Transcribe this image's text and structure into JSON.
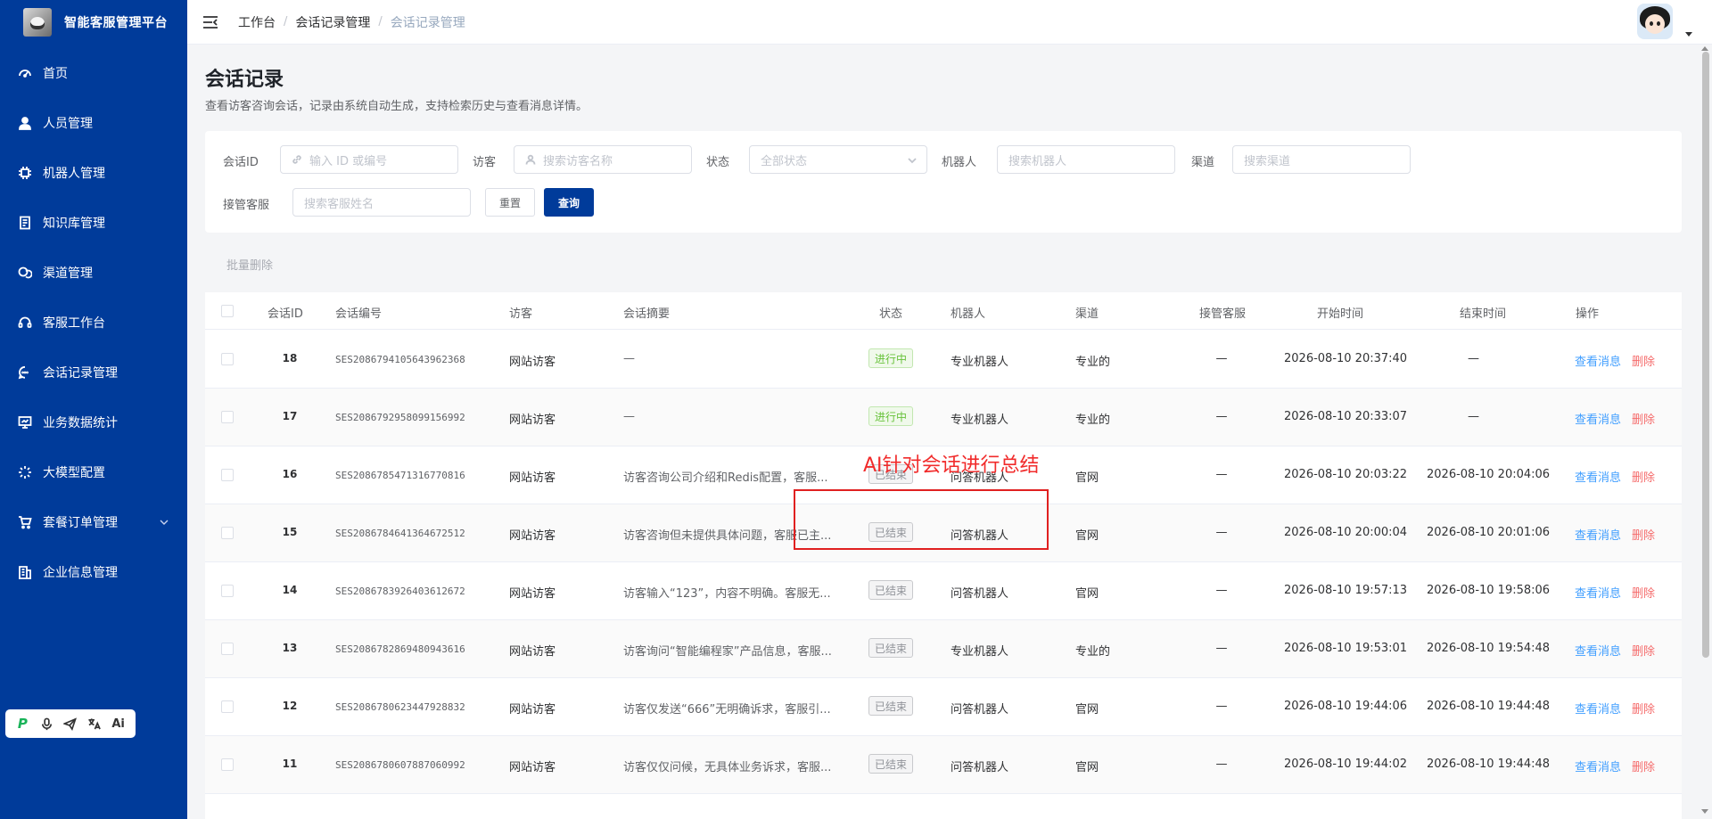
{
  "sidebar": {
    "title": "智能客服管理平台",
    "items": [
      {
        "label": "首页",
        "icon": "dashboard-icon"
      },
      {
        "label": "人员管理",
        "icon": "user-icon"
      },
      {
        "label": "机器人管理",
        "icon": "chip-icon"
      },
      {
        "label": "知识库管理",
        "icon": "book-icon"
      },
      {
        "label": "渠道管理",
        "icon": "link-icon"
      },
      {
        "label": "客服工作台",
        "icon": "headset-icon"
      },
      {
        "label": "会话记录管理",
        "icon": "chat-icon"
      },
      {
        "label": "业务数据统计",
        "icon": "monitor-icon"
      },
      {
        "label": "大模型配置",
        "icon": "sparkle-icon"
      },
      {
        "label": "套餐订单管理",
        "icon": "cart-icon",
        "has_children": true
      },
      {
        "label": "企业信息管理",
        "icon": "building-icon"
      }
    ]
  },
  "header": {
    "breadcrumb": [
      "工作台",
      "会话记录管理",
      "会话记录管理"
    ]
  },
  "page": {
    "title": "会话记录",
    "subtitle": "查看访客咨询会话，记录由系统自动生成，支持检索历史与查看消息详情。"
  },
  "filters": {
    "session_id_label": "会话ID",
    "session_id_placeholder": "输入 ID 或编号",
    "visitor_label": "访客",
    "visitor_placeholder": "搜索访客名称",
    "status_label": "状态",
    "status_value": "全部状态",
    "robot_label": "机器人",
    "robot_placeholder": "搜索机器人",
    "channel_label": "渠道",
    "channel_placeholder": "搜索渠道",
    "agent_label": "接管客服",
    "agent_placeholder": "搜索客服姓名",
    "reset_label": "重置",
    "query_label": "查询"
  },
  "batch_delete_label": "批量删除",
  "table": {
    "headers": {
      "id": "会话ID",
      "no": "会话编号",
      "visitor": "访客",
      "summary": "会话摘要",
      "status": "状态",
      "robot": "机器人",
      "channel": "渠道",
      "agent": "接管客服",
      "start": "开始时间",
      "end": "结束时间",
      "ops": "操作"
    },
    "view_label": "查看消息",
    "delete_label": "删除",
    "rows": [
      {
        "id": "18",
        "no": "SES2086794105643962368",
        "visitor": "网站访客",
        "summary": "—",
        "status": "进行中",
        "status_type": "run",
        "robot": "专业机器人",
        "channel": "专业的",
        "agent": "—",
        "start": "2026-08-10 20:37:40",
        "end": "—"
      },
      {
        "id": "17",
        "no": "SES2086792958099156992",
        "visitor": "网站访客",
        "summary": "—",
        "status": "进行中",
        "status_type": "run",
        "robot": "专业机器人",
        "channel": "专业的",
        "agent": "—",
        "start": "2026-08-10 20:33:07",
        "end": "—"
      },
      {
        "id": "16",
        "no": "SES2086785471316770816",
        "visitor": "网站访客",
        "summary": "访客咨询公司介绍和Redis配置，客服...",
        "status": "已结束",
        "status_type": "end",
        "robot": "问答机器人",
        "channel": "官网",
        "agent": "—",
        "start": "2026-08-10 20:03:22",
        "end": "2026-08-10 20:04:06"
      },
      {
        "id": "15",
        "no": "SES2086784641364672512",
        "visitor": "网站访客",
        "summary": "访客咨询但未提供具体问题，客服已主...",
        "status": "已结束",
        "status_type": "end",
        "robot": "问答机器人",
        "channel": "官网",
        "agent": "—",
        "start": "2026-08-10 20:00:04",
        "end": "2026-08-10 20:01:06"
      },
      {
        "id": "14",
        "no": "SES2086783926403612672",
        "visitor": "网站访客",
        "summary": "访客输入“123”，内容不明确。客服无...",
        "status": "已结束",
        "status_type": "end",
        "robot": "问答机器人",
        "channel": "官网",
        "agent": "—",
        "start": "2026-08-10 19:57:13",
        "end": "2026-08-10 19:58:06"
      },
      {
        "id": "13",
        "no": "SES2086782869480943616",
        "visitor": "网站访客",
        "summary": "访客询问“智能编程家”产品信息，客服...",
        "status": "已结束",
        "status_type": "end",
        "robot": "专业机器人",
        "channel": "专业的",
        "agent": "—",
        "start": "2026-08-10 19:53:01",
        "end": "2026-08-10 19:54:48"
      },
      {
        "id": "12",
        "no": "SES2086780623447928832",
        "visitor": "网站访客",
        "summary": "访客仅发送“666”无明确诉求，客服引...",
        "status": "已结束",
        "status_type": "end",
        "robot": "问答机器人",
        "channel": "官网",
        "agent": "—",
        "start": "2026-08-10 19:44:06",
        "end": "2026-08-10 19:44:48"
      },
      {
        "id": "11",
        "no": "SES2086780607887060992",
        "visitor": "网站访客",
        "summary": "访客仅仅问候，无具体业务诉求，客服...",
        "status": "已结束",
        "status_type": "end",
        "robot": "问答机器人",
        "channel": "官网",
        "agent": "—",
        "start": "2026-08-10 19:44:02",
        "end": "2026-08-10 19:44:48"
      }
    ]
  },
  "annotation": {
    "text": "AI针对会话进行总结",
    "color": "#f12b2b"
  },
  "colors": {
    "sidebar_bg": "#003b9a",
    "primary": "#003b9a",
    "link": "#409eff",
    "danger": "#f56c6c",
    "success": "#67c23a"
  }
}
